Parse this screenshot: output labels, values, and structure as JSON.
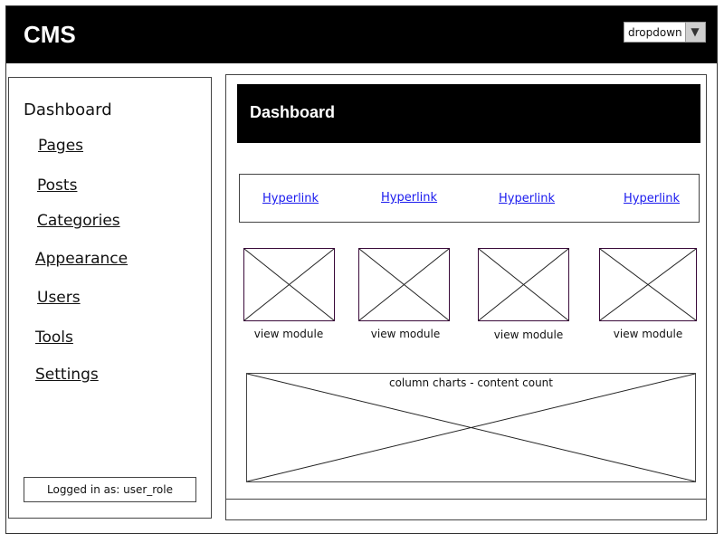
{
  "header": {
    "app_title": "CMS",
    "dropdown": {
      "selected": "dropdown",
      "arrow_icon": "triangle-down"
    }
  },
  "sidebar": {
    "heading": "Dashboard",
    "items": [
      {
        "label": "Pages"
      },
      {
        "label": "Posts"
      },
      {
        "label": "Categories"
      },
      {
        "label": "Appearance"
      },
      {
        "label": "Users"
      },
      {
        "label": "Tools"
      },
      {
        "label": "Settings"
      }
    ],
    "logged_in": "Logged in as: user_role"
  },
  "main": {
    "title": "Dashboard",
    "links": [
      {
        "label": "Hyperlink"
      },
      {
        "label": "Hyperlink"
      },
      {
        "label": "Hyperlink"
      },
      {
        "label": "Hyperlink"
      }
    ],
    "modules": [
      {
        "caption": "view module"
      },
      {
        "caption": "view module"
      },
      {
        "caption": "view module"
      },
      {
        "caption": "view module"
      }
    ],
    "chart_placeholder": {
      "label": "column charts - content count"
    }
  },
  "colors": {
    "header_bg": "#000000",
    "link": "#1a1aee",
    "module_border": "#3a0a3a"
  }
}
